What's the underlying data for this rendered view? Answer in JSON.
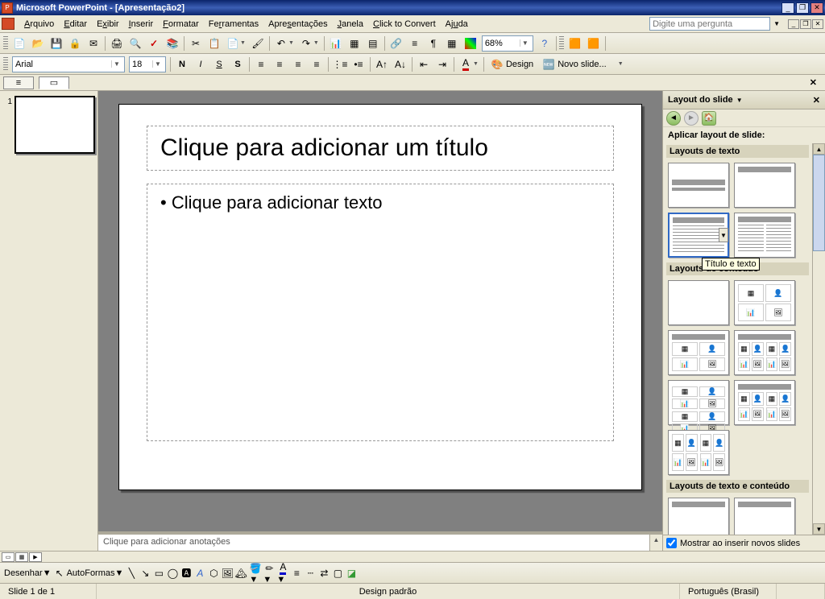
{
  "title_bar": {
    "text": "Microsoft PowerPoint - [Apresentação2]"
  },
  "menu": {
    "items": [
      "Arquivo",
      "Editar",
      "Exibir",
      "Inserir",
      "Formatar",
      "Ferramentas",
      "Apresentações",
      "Janela",
      "Click to Convert",
      "Ajuda"
    ],
    "ask_placeholder": "Digite uma pergunta"
  },
  "formatting": {
    "font": "Arial",
    "size": "18",
    "design_label": "Design",
    "new_slide_label": "Novo slide..."
  },
  "toolbar": {
    "zoom": "68%"
  },
  "thumbs": {
    "num1": "1"
  },
  "slide": {
    "title_ph": "Clique para adicionar um título",
    "body_ph": "Clique para adicionar texto",
    "notes_ph": "Clique para adicionar anotações"
  },
  "taskpane": {
    "title": "Layout do slide",
    "apply_label": "Aplicar layout de slide:",
    "section_text": "Layouts de texto",
    "section_content": "Layouts de conteúdo",
    "section_text_content": "Layouts de texto e conteúdo",
    "tooltip": "Título e texto",
    "show_on_insert": "Mostrar ao inserir novos slides"
  },
  "draw": {
    "desenhar": "Desenhar",
    "autoformas": "AutoFormas"
  },
  "status": {
    "slide": "Slide 1 de 1",
    "design": "Design padrão",
    "lang": "Português (Brasil)"
  }
}
